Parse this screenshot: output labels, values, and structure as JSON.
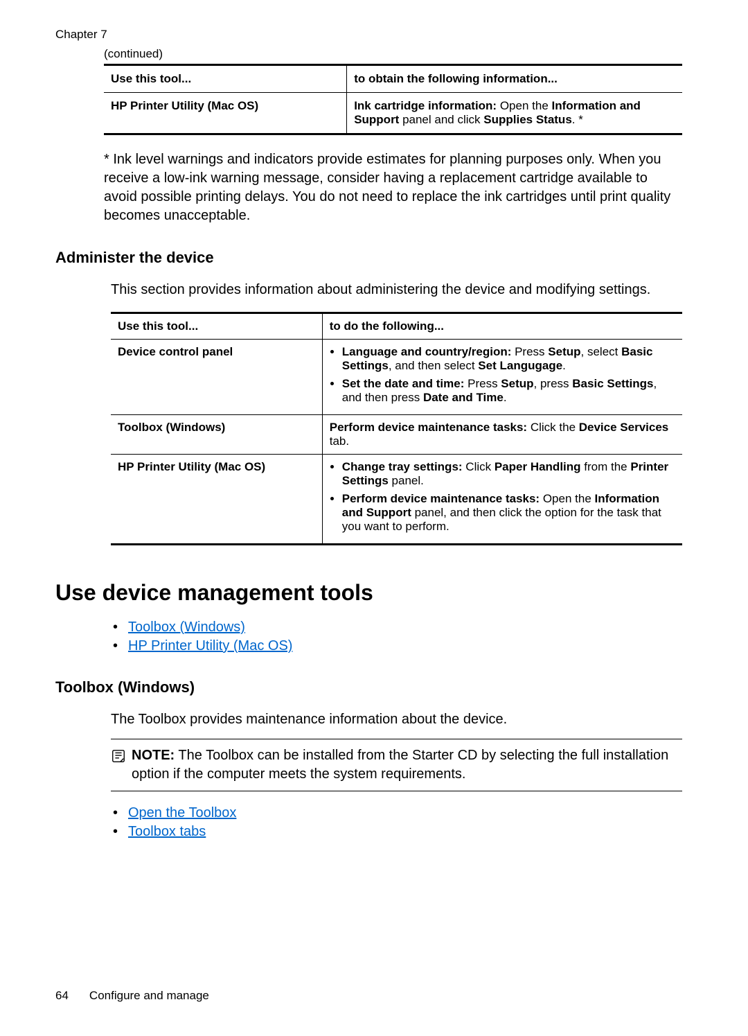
{
  "chapter_label": "Chapter 7",
  "continued_label": "(continued)",
  "table1": {
    "header_left": "Use this tool...",
    "header_right": "to obtain the following information...",
    "row1_left": "HP Printer Utility (Mac OS)",
    "row1_right_b1": "Ink cartridge information:",
    "row1_right_t1": " Open the ",
    "row1_right_b2": "Information and Support",
    "row1_right_t2": " panel and click ",
    "row1_right_b3": "Supplies Status",
    "row1_right_t3": ". *"
  },
  "footnote": "* Ink level warnings and indicators provide estimates for planning purposes only. When you receive a low-ink warning message, consider having a replacement cartridge available to avoid possible printing delays. You do not need to replace the ink cartridges until print quality becomes unacceptable.",
  "admin_heading": "Administer the device",
  "admin_intro": "This section provides information about administering the device and modifying settings.",
  "table2": {
    "header_left": "Use this tool...",
    "header_right": "to do the following...",
    "r1_left": "Device control panel",
    "r1_li1_b1": "Language and country/region:",
    "r1_li1_t1": " Press ",
    "r1_li1_b2": "Setup",
    "r1_li1_t2": ", select ",
    "r1_li1_b3": "Basic Settings",
    "r1_li1_t3": ", and then select ",
    "r1_li1_b4": "Set Langugage",
    "r1_li1_t4": ".",
    "r1_li2_b1": "Set the date and time:",
    "r1_li2_t1": " Press ",
    "r1_li2_b2": "Setup",
    "r1_li2_t2": ", press ",
    "r1_li2_b3": "Basic Settings",
    "r1_li2_t3": ", and then press ",
    "r1_li2_b4": "Date and Time",
    "r1_li2_t4": ".",
    "r2_left": "Toolbox (Windows)",
    "r2_b1": "Perform device maintenance tasks:",
    "r2_t1": " Click the ",
    "r2_b2": "Device Services",
    "r2_t2": " tab.",
    "r3_left": "HP Printer Utility (Mac OS)",
    "r3_li1_b1": "Change tray settings:",
    "r3_li1_t1": " Click ",
    "r3_li1_b2": "Paper Handling",
    "r3_li1_t2": " from the ",
    "r3_li1_b3": "Printer Settings",
    "r3_li1_t3": " panel.",
    "r3_li2_b1": "Perform device maintenance tasks:",
    "r3_li2_t1": " Open the ",
    "r3_li2_b2": "Information and Support",
    "r3_li2_t2": " panel, and then click the option for the task that you want to perform."
  },
  "h1_tools": "Use device management tools",
  "links1": {
    "a": "Toolbox (Windows)",
    "b": "HP Printer Utility (Mac OS)"
  },
  "h3_toolbox": "Toolbox (Windows)",
  "toolbox_intro": "The Toolbox provides maintenance information about the device.",
  "note": {
    "label": "NOTE:",
    "text": "  The Toolbox can be installed from the Starter CD by selecting the full installation option if the computer meets the system requirements."
  },
  "links2": {
    "a": "Open the Toolbox",
    "b": "Toolbox tabs"
  },
  "footer": {
    "page_number": "64",
    "section": "Configure and manage"
  }
}
